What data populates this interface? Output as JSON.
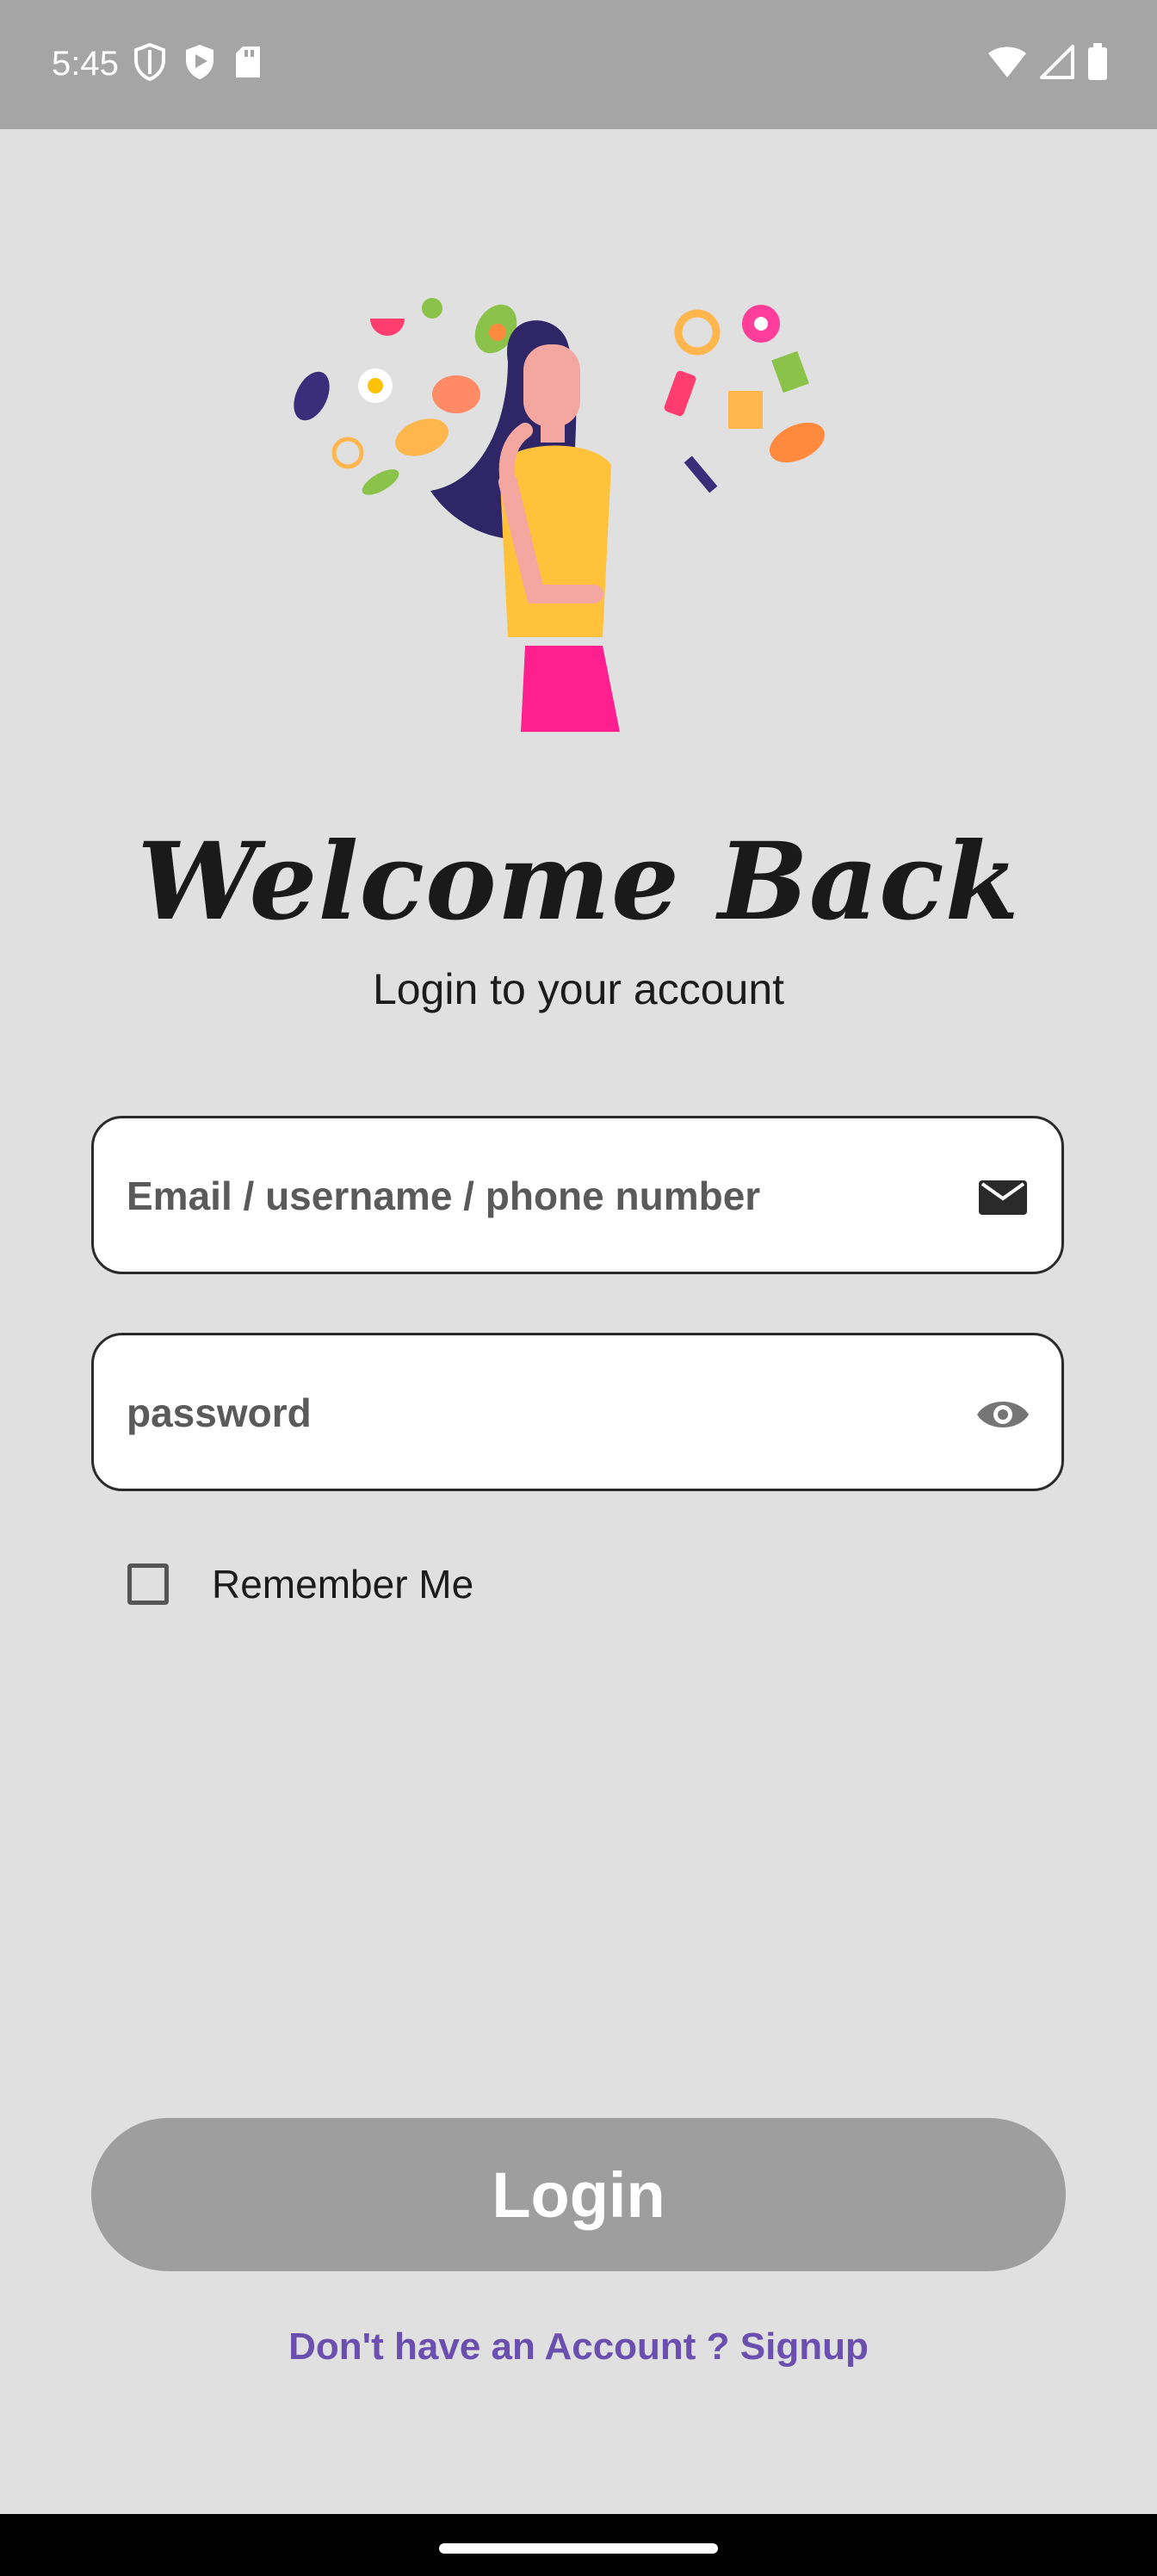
{
  "status_bar": {
    "time": "5:45",
    "left_icons": [
      "shield-icon",
      "play-shield-icon",
      "sd-card-icon"
    ],
    "right_icons": [
      "wifi-icon",
      "cell-signal-icon",
      "battery-icon"
    ]
  },
  "hero": {
    "illustration": "woman-thinking-about-food-illustration"
  },
  "header": {
    "title": "Welcome Back",
    "subtitle": "Login to your account"
  },
  "form": {
    "email": {
      "placeholder": "Email / username / phone number",
      "value": "",
      "icon": "mail-icon"
    },
    "password": {
      "placeholder": "password",
      "value": "",
      "icon": "eye-icon"
    },
    "remember_me": {
      "label": "Remember Me",
      "checked": false
    }
  },
  "actions": {
    "login_label": "Login",
    "signup_label": "Don't have an Account ? Signup"
  },
  "colors": {
    "background": "#e0e0e0",
    "status_bar": "#a5a5a5",
    "login_button": "#9e9e9e",
    "link": "#6b4fb0"
  }
}
